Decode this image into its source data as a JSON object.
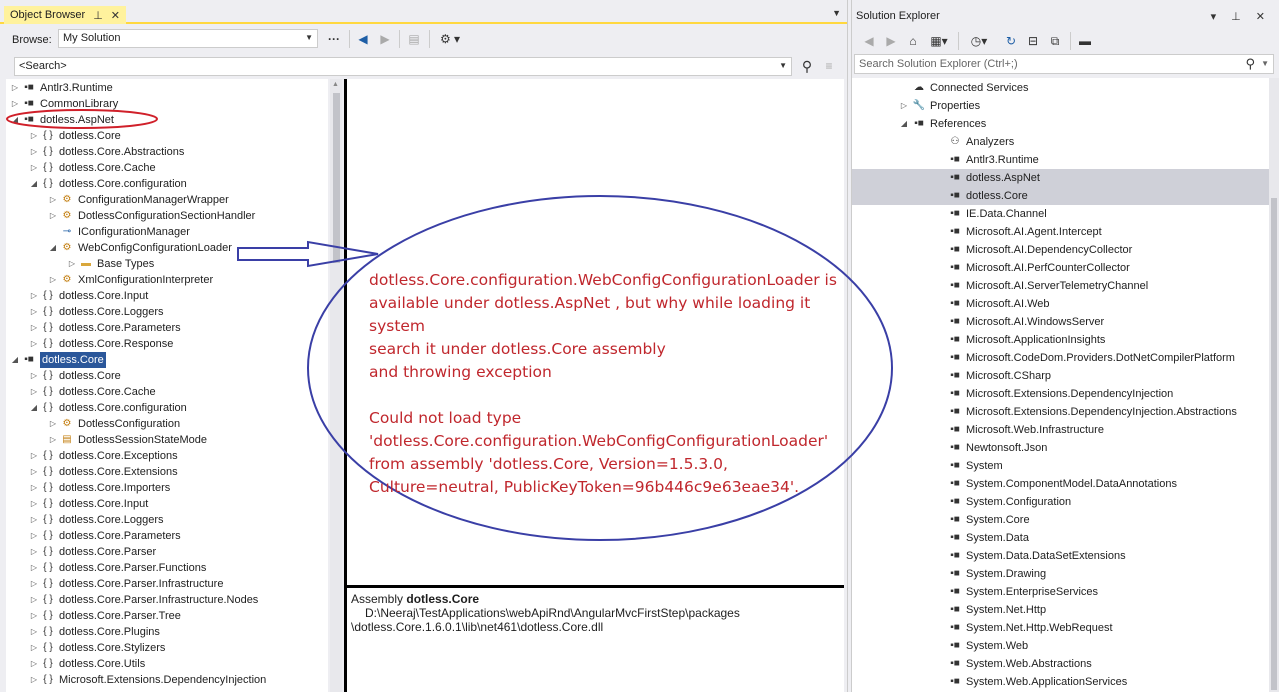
{
  "object_browser": {
    "tab_title": "Object Browser",
    "browse_label": "Browse:",
    "browse_value": "My Solution",
    "search_placeholder": "<Search>",
    "tree": [
      {
        "label": "Antlr3.Runtime",
        "level": 0,
        "exp": "▷",
        "icon": "assembly-icon",
        "glyph": "▪■"
      },
      {
        "label": "CommonLibrary",
        "level": 0,
        "exp": "▷",
        "icon": "assembly-icon",
        "glyph": "▪■"
      },
      {
        "label": "dotless.AspNet",
        "level": 0,
        "exp": "◢",
        "icon": "assembly-icon",
        "glyph": "▪■"
      },
      {
        "label": "dotless.Core",
        "level": 1,
        "exp": "▷",
        "icon": "namespace-icon",
        "glyph": "{ }"
      },
      {
        "label": "dotless.Core.Abstractions",
        "level": 1,
        "exp": "▷",
        "icon": "namespace-icon",
        "glyph": "{ }"
      },
      {
        "label": "dotless.Core.Cache",
        "level": 1,
        "exp": "▷",
        "icon": "namespace-icon",
        "glyph": "{ }"
      },
      {
        "label": "dotless.Core.configuration",
        "level": 1,
        "exp": "◢",
        "icon": "namespace-icon",
        "glyph": "{ }"
      },
      {
        "label": "ConfigurationManagerWrapper",
        "level": 2,
        "exp": "▷",
        "icon": "class-icon",
        "glyph": "⚙"
      },
      {
        "label": "DotlessConfigurationSectionHandler",
        "level": 2,
        "exp": "▷",
        "icon": "class-icon",
        "glyph": "⚙"
      },
      {
        "label": "IConfigurationManager",
        "level": 2,
        "exp": "",
        "icon": "interface-icon",
        "glyph": "⊸"
      },
      {
        "label": "WebConfigConfigurationLoader",
        "level": 2,
        "exp": "◢",
        "icon": "class-icon",
        "glyph": "⚙"
      },
      {
        "label": "Base Types",
        "level": 3,
        "exp": "▷",
        "icon": "folder-icon",
        "glyph": "▬"
      },
      {
        "label": "XmlConfigurationInterpreter",
        "level": 2,
        "exp": "▷",
        "icon": "class-icon",
        "glyph": "⚙"
      },
      {
        "label": "dotless.Core.Input",
        "level": 1,
        "exp": "▷",
        "icon": "namespace-icon",
        "glyph": "{ }"
      },
      {
        "label": "dotless.Core.Loggers",
        "level": 1,
        "exp": "▷",
        "icon": "namespace-icon",
        "glyph": "{ }"
      },
      {
        "label": "dotless.Core.Parameters",
        "level": 1,
        "exp": "▷",
        "icon": "namespace-icon",
        "glyph": "{ }"
      },
      {
        "label": "dotless.Core.Response",
        "level": 1,
        "exp": "▷",
        "icon": "namespace-icon",
        "glyph": "{ }"
      },
      {
        "label": "dotless.Core",
        "level": 0,
        "exp": "◢",
        "icon": "assembly-icon",
        "glyph": "▪■",
        "selected": true
      },
      {
        "label": "dotless.Core",
        "level": 1,
        "exp": "▷",
        "icon": "namespace-icon",
        "glyph": "{ }"
      },
      {
        "label": "dotless.Core.Cache",
        "level": 1,
        "exp": "▷",
        "icon": "namespace-icon",
        "glyph": "{ }"
      },
      {
        "label": "dotless.Core.configuration",
        "level": 1,
        "exp": "◢",
        "icon": "namespace-icon",
        "glyph": "{ }"
      },
      {
        "label": "DotlessConfiguration",
        "level": 2,
        "exp": "▷",
        "icon": "class-icon",
        "glyph": "⚙"
      },
      {
        "label": "DotlessSessionStateMode",
        "level": 2,
        "exp": "▷",
        "icon": "enum-icon",
        "glyph": "▤"
      },
      {
        "label": "dotless.Core.Exceptions",
        "level": 1,
        "exp": "▷",
        "icon": "namespace-icon",
        "glyph": "{ }"
      },
      {
        "label": "dotless.Core.Extensions",
        "level": 1,
        "exp": "▷",
        "icon": "namespace-icon",
        "glyph": "{ }"
      },
      {
        "label": "dotless.Core.Importers",
        "level": 1,
        "exp": "▷",
        "icon": "namespace-icon",
        "glyph": "{ }"
      },
      {
        "label": "dotless.Core.Input",
        "level": 1,
        "exp": "▷",
        "icon": "namespace-icon",
        "glyph": "{ }"
      },
      {
        "label": "dotless.Core.Loggers",
        "level": 1,
        "exp": "▷",
        "icon": "namespace-icon",
        "glyph": "{ }"
      },
      {
        "label": "dotless.Core.Parameters",
        "level": 1,
        "exp": "▷",
        "icon": "namespace-icon",
        "glyph": "{ }"
      },
      {
        "label": "dotless.Core.Parser",
        "level": 1,
        "exp": "▷",
        "icon": "namespace-icon",
        "glyph": "{ }"
      },
      {
        "label": "dotless.Core.Parser.Functions",
        "level": 1,
        "exp": "▷",
        "icon": "namespace-icon",
        "glyph": "{ }"
      },
      {
        "label": "dotless.Core.Parser.Infrastructure",
        "level": 1,
        "exp": "▷",
        "icon": "namespace-icon",
        "glyph": "{ }"
      },
      {
        "label": "dotless.Core.Parser.Infrastructure.Nodes",
        "level": 1,
        "exp": "▷",
        "icon": "namespace-icon",
        "glyph": "{ }"
      },
      {
        "label": "dotless.Core.Parser.Tree",
        "level": 1,
        "exp": "▷",
        "icon": "namespace-icon",
        "glyph": "{ }"
      },
      {
        "label": "dotless.Core.Plugins",
        "level": 1,
        "exp": "▷",
        "icon": "namespace-icon",
        "glyph": "{ }"
      },
      {
        "label": "dotless.Core.Stylizers",
        "level": 1,
        "exp": "▷",
        "icon": "namespace-icon",
        "glyph": "{ }"
      },
      {
        "label": "dotless.Core.Utils",
        "level": 1,
        "exp": "▷",
        "icon": "namespace-icon",
        "glyph": "{ }"
      },
      {
        "label": "Microsoft.Extensions.DependencyInjection",
        "level": 1,
        "exp": "▷",
        "icon": "namespace-icon",
        "glyph": "{ }"
      }
    ],
    "description": {
      "prefix": "Assembly",
      "name": "dotless.Core",
      "path_line1": "D:\\Neeraj\\TestApplications\\webApiRnd\\AngularMvcFirstStep\\packages",
      "path_line2": "\\dotless.Core.1.6.0.1\\lib\\net461\\dotless.Core.dll"
    }
  },
  "annotation": {
    "color": "#c0272d",
    "circle_color": "#3a3fa6",
    "lines": [
      "dotless.Core.configuration.WebConfigConfigurationLoader is",
      "available under dotless.AspNet , but why while loading it system",
      "search it under dotless.Core assembly",
      "and throwing exception",
      "",
      "Could not load type",
      "'dotless.Core.configuration.WebConfigConfigurationLoader'",
      "from assembly 'dotless.Core, Version=1.5.3.0,",
      "Culture=neutral, PublicKeyToken=96b446c9e63eae34'."
    ]
  },
  "solution_explorer": {
    "title": "Solution Explorer",
    "search_placeholder": "Search Solution Explorer (Ctrl+;)",
    "items": [
      {
        "label": "Connected Services",
        "indent": 2,
        "exp": "",
        "icon": "connected-services-icon",
        "glyph": "☁"
      },
      {
        "label": "Properties",
        "indent": 2,
        "exp": "▷",
        "icon": "wrench-icon",
        "glyph": "🔧"
      },
      {
        "label": "References",
        "indent": 2,
        "exp": "◢",
        "icon": "references-icon",
        "glyph": "▪■"
      },
      {
        "label": "Analyzers",
        "indent": 3,
        "exp": "",
        "icon": "analyzer-icon",
        "glyph": "⚇"
      },
      {
        "label": "Antlr3.Runtime",
        "indent": 3,
        "exp": "",
        "icon": "reference-icon",
        "glyph": "▪■"
      },
      {
        "label": "dotless.AspNet",
        "indent": 3,
        "exp": "",
        "icon": "reference-icon",
        "glyph": "▪■",
        "highlight": true
      },
      {
        "label": "dotless.Core",
        "indent": 3,
        "exp": "",
        "icon": "reference-icon",
        "glyph": "▪■",
        "highlight": true
      },
      {
        "label": "IE.Data.Channel",
        "indent": 3,
        "exp": "",
        "icon": "reference-icon",
        "glyph": "▪■"
      },
      {
        "label": "Microsoft.AI.Agent.Intercept",
        "indent": 3,
        "exp": "",
        "icon": "reference-icon",
        "glyph": "▪■"
      },
      {
        "label": "Microsoft.AI.DependencyCollector",
        "indent": 3,
        "exp": "",
        "icon": "reference-icon",
        "glyph": "▪■"
      },
      {
        "label": "Microsoft.AI.PerfCounterCollector",
        "indent": 3,
        "exp": "",
        "icon": "reference-icon",
        "glyph": "▪■"
      },
      {
        "label": "Microsoft.AI.ServerTelemetryChannel",
        "indent": 3,
        "exp": "",
        "icon": "reference-icon",
        "glyph": "▪■"
      },
      {
        "label": "Microsoft.AI.Web",
        "indent": 3,
        "exp": "",
        "icon": "reference-icon",
        "glyph": "▪■"
      },
      {
        "label": "Microsoft.AI.WindowsServer",
        "indent": 3,
        "exp": "",
        "icon": "reference-icon",
        "glyph": "▪■"
      },
      {
        "label": "Microsoft.ApplicationInsights",
        "indent": 3,
        "exp": "",
        "icon": "reference-icon",
        "glyph": "▪■"
      },
      {
        "label": "Microsoft.CodeDom.Providers.DotNetCompilerPlatform",
        "indent": 3,
        "exp": "",
        "icon": "reference-icon",
        "glyph": "▪■"
      },
      {
        "label": "Microsoft.CSharp",
        "indent": 3,
        "exp": "",
        "icon": "reference-icon",
        "glyph": "▪■"
      },
      {
        "label": "Microsoft.Extensions.DependencyInjection",
        "indent": 3,
        "exp": "",
        "icon": "reference-icon",
        "glyph": "▪■"
      },
      {
        "label": "Microsoft.Extensions.DependencyInjection.Abstractions",
        "indent": 3,
        "exp": "",
        "icon": "reference-icon",
        "glyph": "▪■"
      },
      {
        "label": "Microsoft.Web.Infrastructure",
        "indent": 3,
        "exp": "",
        "icon": "reference-icon",
        "glyph": "▪■"
      },
      {
        "label": "Newtonsoft.Json",
        "indent": 3,
        "exp": "",
        "icon": "reference-icon",
        "glyph": "▪■"
      },
      {
        "label": "System",
        "indent": 3,
        "exp": "",
        "icon": "reference-icon",
        "glyph": "▪■"
      },
      {
        "label": "System.ComponentModel.DataAnnotations",
        "indent": 3,
        "exp": "",
        "icon": "reference-icon",
        "glyph": "▪■"
      },
      {
        "label": "System.Configuration",
        "indent": 3,
        "exp": "",
        "icon": "reference-icon",
        "glyph": "▪■"
      },
      {
        "label": "System.Core",
        "indent": 3,
        "exp": "",
        "icon": "reference-icon",
        "glyph": "▪■"
      },
      {
        "label": "System.Data",
        "indent": 3,
        "exp": "",
        "icon": "reference-icon",
        "glyph": "▪■"
      },
      {
        "label": "System.Data.DataSetExtensions",
        "indent": 3,
        "exp": "",
        "icon": "reference-icon",
        "glyph": "▪■"
      },
      {
        "label": "System.Drawing",
        "indent": 3,
        "exp": "",
        "icon": "reference-icon",
        "glyph": "▪■"
      },
      {
        "label": "System.EnterpriseServices",
        "indent": 3,
        "exp": "",
        "icon": "reference-icon",
        "glyph": "▪■"
      },
      {
        "label": "System.Net.Http",
        "indent": 3,
        "exp": "",
        "icon": "reference-icon",
        "glyph": "▪■"
      },
      {
        "label": "System.Net.Http.WebRequest",
        "indent": 3,
        "exp": "",
        "icon": "reference-icon",
        "glyph": "▪■"
      },
      {
        "label": "System.Web",
        "indent": 3,
        "exp": "",
        "icon": "reference-icon",
        "glyph": "▪■"
      },
      {
        "label": "System.Web.Abstractions",
        "indent": 3,
        "exp": "",
        "icon": "reference-icon",
        "glyph": "▪■"
      },
      {
        "label": "System.Web.ApplicationServices",
        "indent": 3,
        "exp": "",
        "icon": "reference-icon",
        "glyph": "▪■"
      }
    ]
  },
  "colors": {
    "tab_active": "#fff29d",
    "selection": "#2b579a",
    "highlight_row": "#cfd0d8",
    "annotation_text": "#c0272d",
    "annotation_shape": "#3a3fa6",
    "red_oval": "#d0202a"
  }
}
